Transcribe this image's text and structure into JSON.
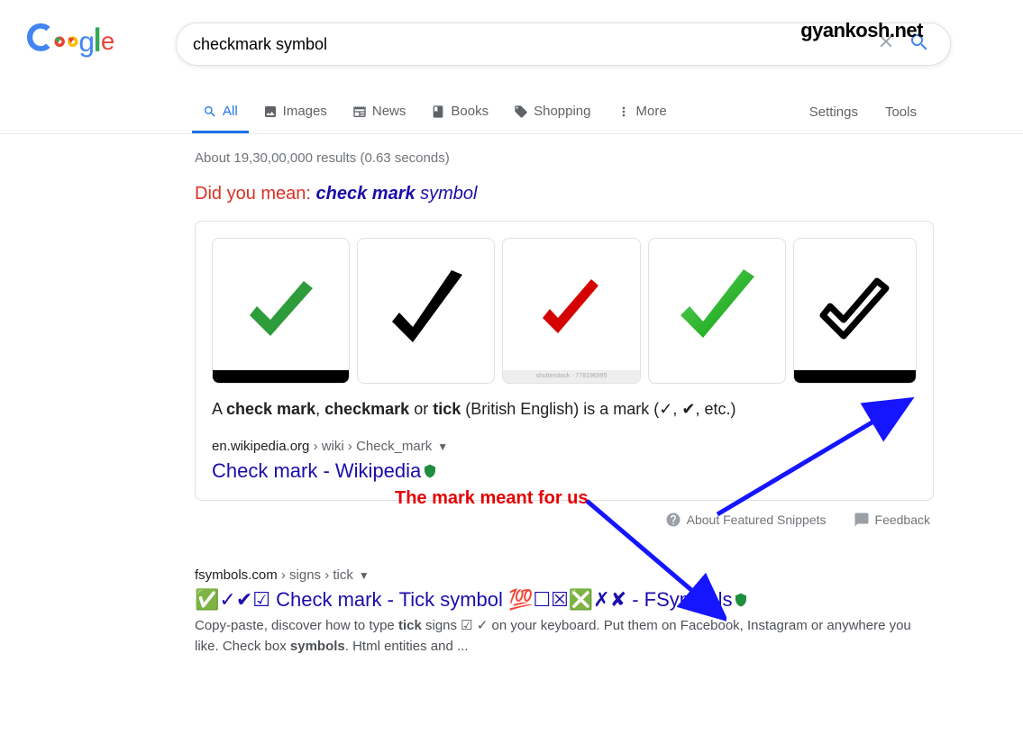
{
  "watermark": "gyankosh.net",
  "search": {
    "query": "checkmark symbol"
  },
  "tabs": {
    "all": "All",
    "images": "Images",
    "news": "News",
    "books": "Books",
    "shopping": "Shopping",
    "more": "More"
  },
  "nav_right": {
    "settings": "Settings",
    "tools": "Tools"
  },
  "stats": "About 19,30,00,000 results (0.63 seconds)",
  "dym": {
    "label": "Did you mean: ",
    "suggestion": "check mark",
    "suffix": " symbol"
  },
  "snippet": {
    "desc_a": "A ",
    "desc_b1": "check mark",
    "desc_c": ", ",
    "desc_b2": "checkmark",
    "desc_d": " or ",
    "desc_b3": "tick",
    "desc_e": " (British English) is a mark (✓, ✔, etc.)",
    "cite_domain": "en.wikipedia.org",
    "cite_path": " › wiki › Check_mark",
    "title": "Check mark - Wikipedia"
  },
  "under": {
    "about": "About Featured Snippets",
    "feedback": "Feedback"
  },
  "annotation": "The mark meant for us",
  "r2": {
    "cite_domain": "fsymbols.com",
    "cite_path": " › signs › tick",
    "title": "✅✓✔☑ Check mark - Tick symbol 💯☐☒❎✗✘ - FSymbols",
    "d1": "Copy-paste, discover how to type ",
    "d2": "tick",
    "d3": " signs ☑ ✓ on your keyboard. Put them on Facebook, Instagram or anywhere you like. Check box ",
    "d4": "symbols",
    "d5": ". Html entities and ..."
  }
}
